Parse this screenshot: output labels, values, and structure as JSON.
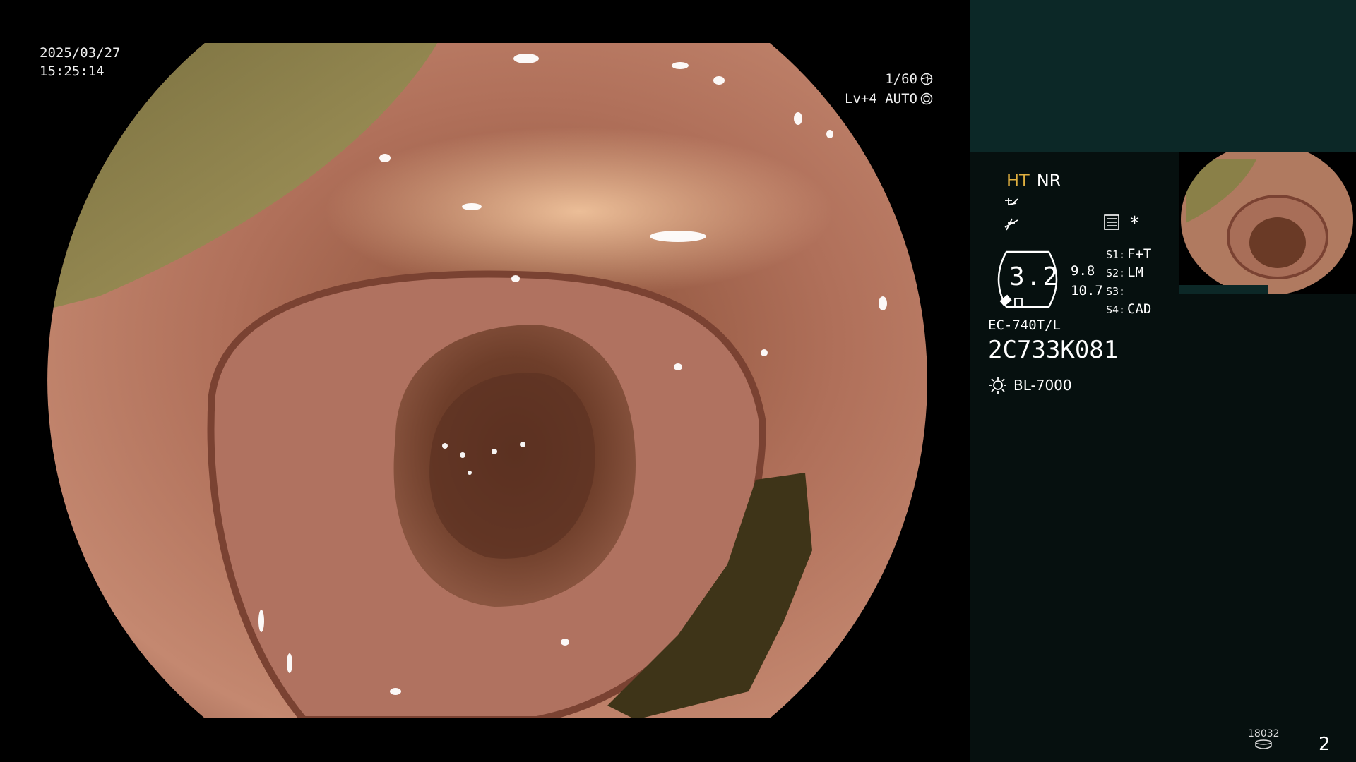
{
  "overlay": {
    "date": "2025/03/27",
    "time": "15:25:14",
    "shutter": "1/60",
    "level": "Lv+4 AUTO"
  },
  "panel": {
    "mode_ht": "HT",
    "mode_nr": "NR",
    "ring_value": "3.2",
    "num_a": "9.8",
    "num_b": "10.7",
    "switches": [
      {
        "key": "S1:",
        "value": "F+T"
      },
      {
        "key": "S2:",
        "value": "LM"
      },
      {
        "key": "S3:",
        "value": ""
      },
      {
        "key": "S4:",
        "value": "CAD"
      }
    ],
    "scope_model": "EC-740T/L",
    "scope_serial": "2C733K081",
    "light_source": "BL-7000",
    "storage_count": "18032",
    "page_number": "2"
  },
  "icons": {
    "shutter_icon": "aperture-icon",
    "level_icon": "iris-icon",
    "light_icon": "sun-icon",
    "storage_icon": "disk-icon",
    "record_icon": "record-icon"
  },
  "colors": {
    "panel_top": "#0c2827",
    "panel_bg": "#06100f",
    "ht_color": "#e0b040"
  }
}
